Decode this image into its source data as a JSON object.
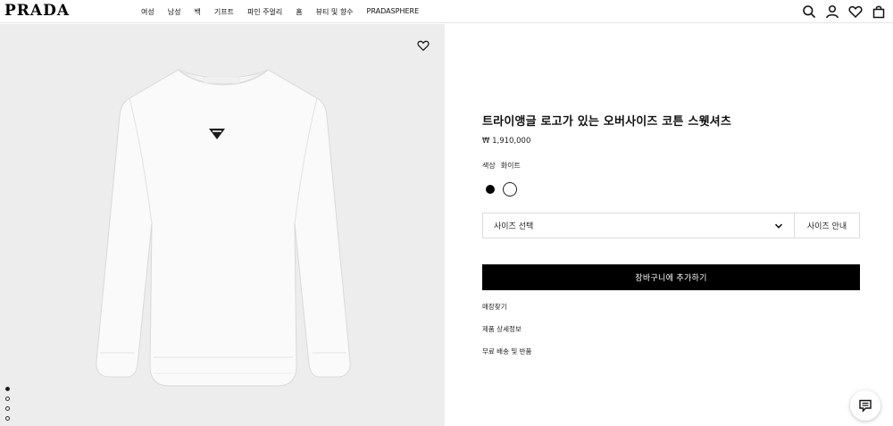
{
  "header": {
    "logo": "PRADA",
    "nav": [
      "여성",
      "남성",
      "백",
      "기프트",
      "파인 주얼리",
      "홈",
      "뷰티 및 향수",
      "PRADASPHERE"
    ],
    "icons": [
      "search-icon",
      "account-icon",
      "wishlist-icon",
      "bag-icon"
    ]
  },
  "gallery": {
    "image": "white-sweatshirt",
    "dots_total": 4,
    "active_dot": 1,
    "favorite_icon": "heart-icon"
  },
  "product": {
    "title": "트라이앵글 로고가 있는 오버사이즈 코튼 스웻셔츠",
    "price": "₩ 1,910,000",
    "color_label": "색상",
    "color_value": "화이트",
    "swatches": [
      {
        "name": "black",
        "color": "#000000"
      },
      {
        "name": "white",
        "color": "#ffffff",
        "selected": true
      }
    ],
    "size_select": "사이즈 선택",
    "size_guide": "사이즈 안내",
    "add_to_cart": "장바구니에 추가하기",
    "links": [
      "매장찾기",
      "제품 상세정보",
      "무료 배송 및 반품"
    ]
  },
  "chat": {
    "icon": "chat-icon"
  },
  "colors": {
    "accent": "#000000",
    "gallery_bg": "#ededed",
    "border": "#dcdcdc"
  }
}
